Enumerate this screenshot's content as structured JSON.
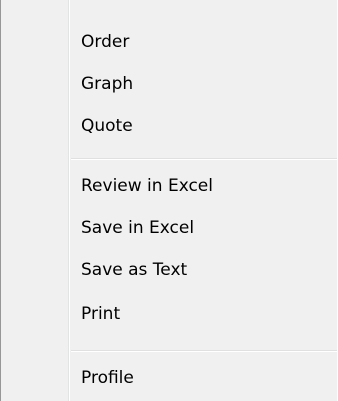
{
  "menu": {
    "groups": [
      {
        "items": [
          {
            "label": "Order"
          },
          {
            "label": "Graph"
          },
          {
            "label": "Quote"
          }
        ]
      },
      {
        "items": [
          {
            "label": "Review in Excel"
          },
          {
            "label": "Save in Excel"
          },
          {
            "label": "Save as Text"
          },
          {
            "label": "Print"
          }
        ]
      },
      {
        "items": [
          {
            "label": "Profile"
          }
        ]
      }
    ]
  },
  "colors": {
    "background": "#f0f0f0",
    "separator": "#e0e0e0",
    "border": "#979797",
    "text": "#000000"
  }
}
